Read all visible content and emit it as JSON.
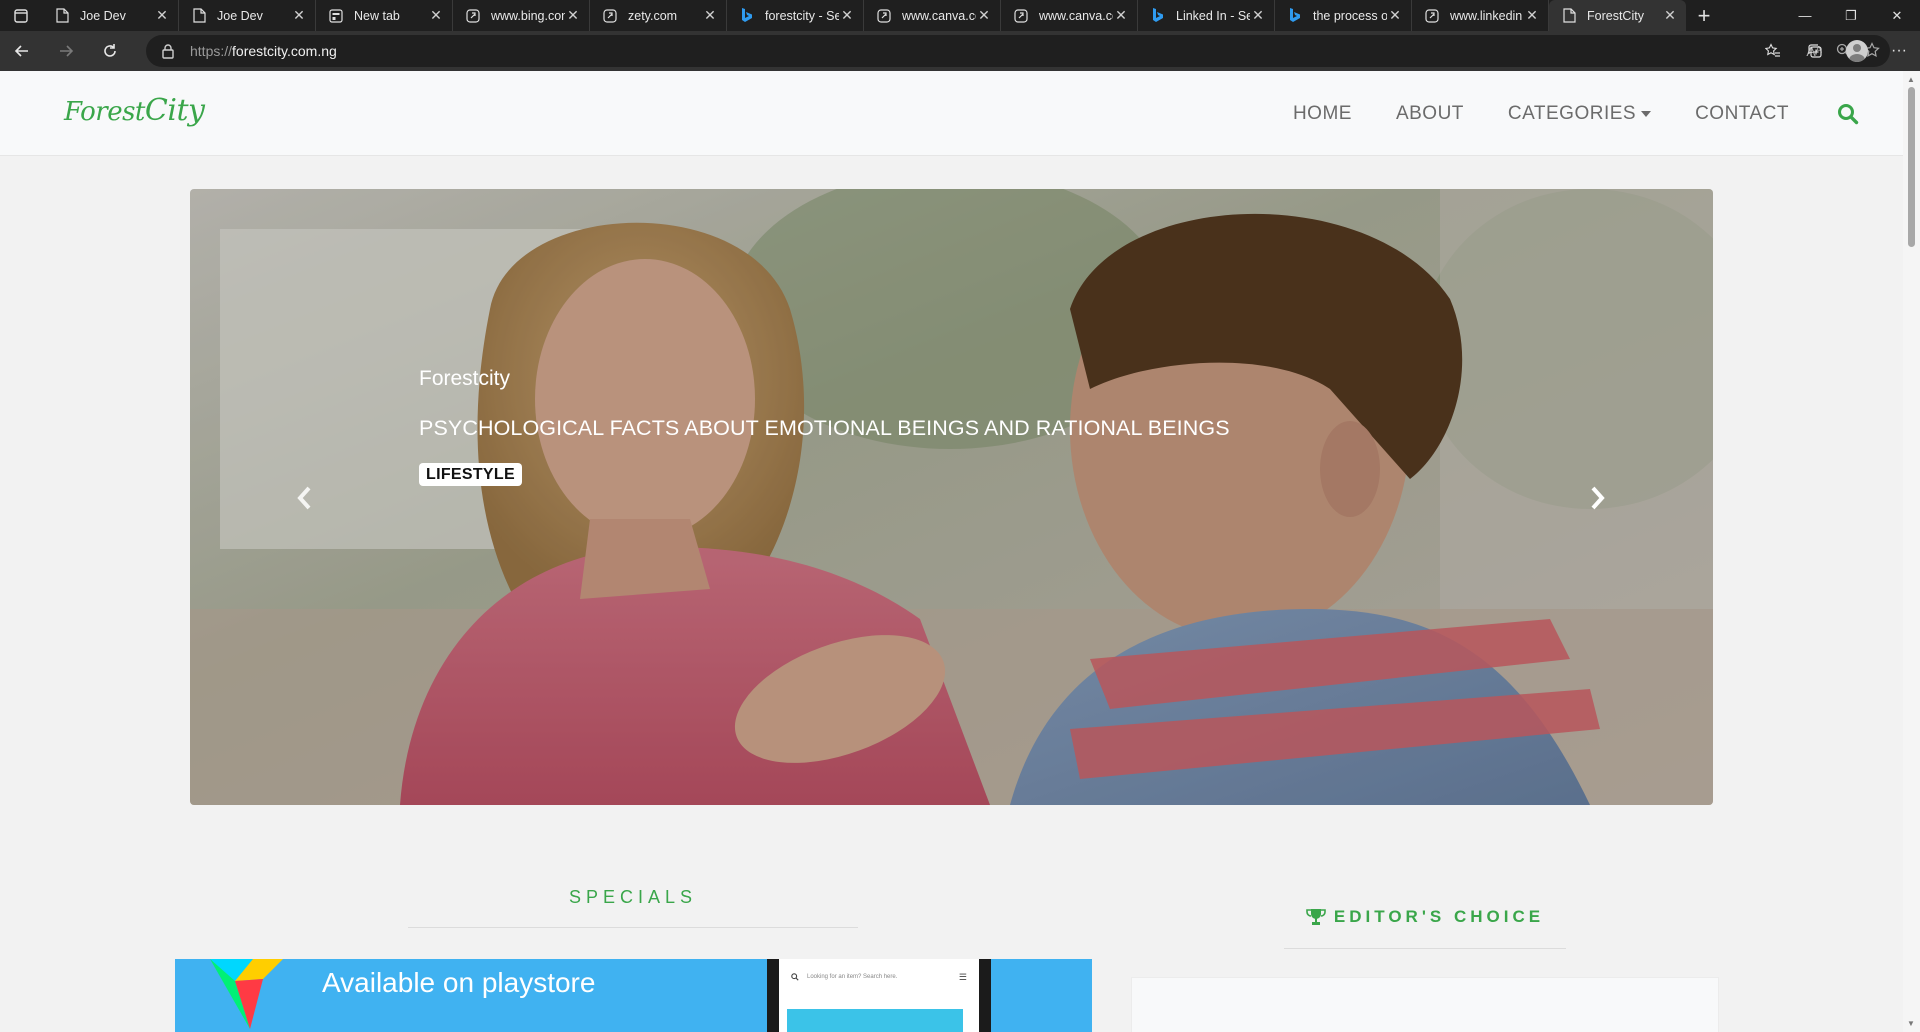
{
  "browser": {
    "tabs": [
      {
        "title": "Joe Dev",
        "favicon": "page-icon"
      },
      {
        "title": "Joe Dev",
        "favicon": "page-icon"
      },
      {
        "title": "New tab",
        "favicon": "newtab-icon"
      },
      {
        "title": "www.bing.con",
        "favicon": "link-icon"
      },
      {
        "title": "zety.com",
        "favicon": "link-icon"
      },
      {
        "title": "forestcity - Se",
        "favicon": "bing-icon"
      },
      {
        "title": "www.canva.cc",
        "favicon": "link-icon"
      },
      {
        "title": "www.canva.cc",
        "favicon": "link-icon"
      },
      {
        "title": "Linked In - Se",
        "favicon": "bing-icon"
      },
      {
        "title": "the process o",
        "favicon": "bing-icon"
      },
      {
        "title": "www.linkedin",
        "favicon": "link-icon"
      },
      {
        "title": "ForestCity",
        "favicon": "page-icon",
        "active": true
      }
    ],
    "url_scheme": "https://",
    "url_host": "forestcity.com.ng",
    "read_aloud": "Aᴬ"
  },
  "site": {
    "logo": {
      "part1": "Forest",
      "part2": "City"
    },
    "nav": {
      "home": "HOME",
      "about": "ABOUT",
      "categories": "CATEGORIES",
      "contact": "CONTACT"
    },
    "accent_color": "#3aa64a"
  },
  "hero": {
    "site": "Forestcity",
    "title": "PSYCHOLOGICAL FACTS ABOUT EMOTIONAL BEINGS AND RATIONAL BEINGS",
    "badge": "LIFESTYLE"
  },
  "specials": {
    "title": "SPECIALS"
  },
  "editors_choice": {
    "title": "EDITOR'S CHOICE",
    "icon": "trophy-icon"
  },
  "promo": {
    "text": "Available on playstore",
    "phone_search_placeholder": "Looking for an item? Search here.",
    "bg_color": "#40b2f1"
  }
}
